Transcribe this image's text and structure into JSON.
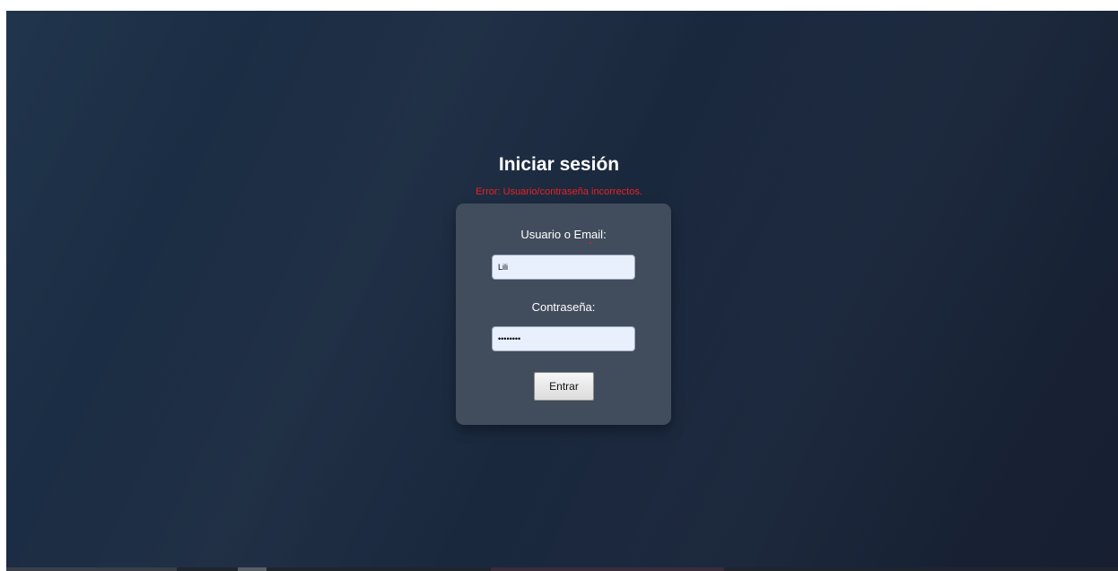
{
  "login": {
    "title": "Iniciar sesión",
    "error_message": "Error: Usuario/contraseña incorrectos.",
    "username_label": "Usuario o Email:",
    "username_value": "Lili",
    "password_label": "Contraseña:",
    "password_value": "••••••••",
    "submit_label": "Entrar"
  },
  "colors": {
    "background": "#1b2a40",
    "card": "#414c5c",
    "error": "#e8211f",
    "input_fill": "#e8f0fe"
  }
}
